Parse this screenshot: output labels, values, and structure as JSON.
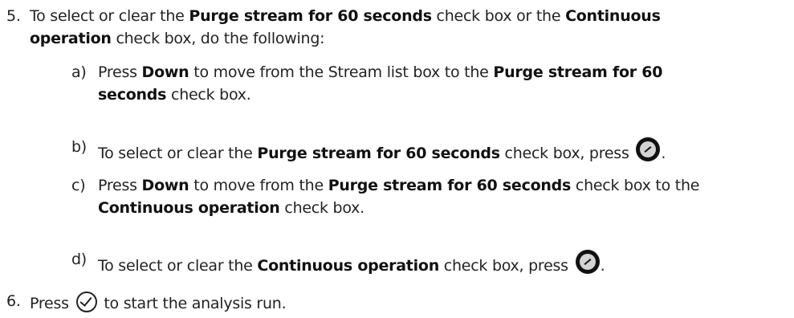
{
  "step5": {
    "num": "5.",
    "l1_a": "To select or clear the ",
    "l1_b": "Purge stream for 60 seconds",
    "l1_c": " check box or the ",
    "l1_d": "Continuous",
    "l2_a": "operation",
    "l2_b": " check box, do the following:"
  },
  "sub_a": {
    "label": "a)",
    "l1_a": "Press ",
    "l1_b": "Down",
    "l1_c": " to move from the Stream list box to the ",
    "l1_d": "Purge stream for 60",
    "l2_a": "seconds",
    "l2_b": " check box."
  },
  "sub_b": {
    "label": "b)",
    "t1": "To select or clear the ",
    "t2": "Purge stream for 60 seconds",
    "t3": " check box, press ",
    "t4": "."
  },
  "sub_c": {
    "label": "c)",
    "l1_a": "Press ",
    "l1_b": "Down",
    "l1_c": " to move from the ",
    "l1_d": "Purge stream for 60 seconds",
    "l1_e": " check box to the",
    "l2_a": "Continuous operation",
    "l2_b": " check box."
  },
  "sub_d": {
    "label": "d)",
    "t1": "To select or clear the ",
    "t2": "Continuous operation",
    "t3": " check box, press ",
    "t4": "."
  },
  "step6": {
    "num": "6.",
    "t1": "Press ",
    "t2": " to start the analysis run."
  },
  "icons": {
    "enter_key": "enter-key-icon",
    "ok_key": "ok-check-icon"
  }
}
